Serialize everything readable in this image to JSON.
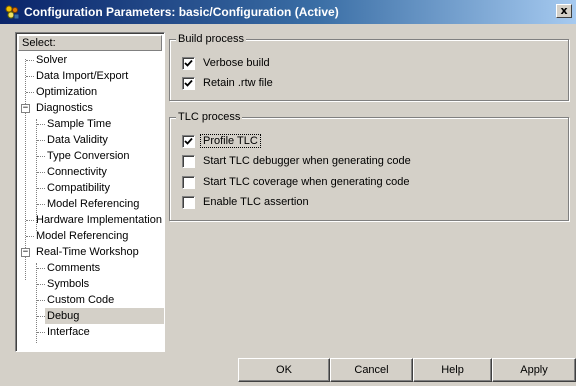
{
  "window": {
    "title": "Configuration Parameters: basic/Configuration (Active)",
    "close_glyph": "x"
  },
  "tree": {
    "header": "Select:",
    "items": [
      {
        "label": "Solver",
        "level": 1
      },
      {
        "label": "Data Import/Export",
        "level": 1
      },
      {
        "label": "Optimization",
        "level": 1
      },
      {
        "label": "Diagnostics",
        "level": 1,
        "expanded": true
      },
      {
        "label": "Sample Time",
        "level": 2
      },
      {
        "label": "Data Validity",
        "level": 2
      },
      {
        "label": "Type Conversion",
        "level": 2
      },
      {
        "label": "Connectivity",
        "level": 2
      },
      {
        "label": "Compatibility",
        "level": 2
      },
      {
        "label": "Model Referencing",
        "level": 2
      },
      {
        "label": "Hardware Implementation",
        "level": 1
      },
      {
        "label": "Model Referencing",
        "level": 1
      },
      {
        "label": "Real-Time Workshop",
        "level": 1,
        "expanded": true
      },
      {
        "label": "Comments",
        "level": 2
      },
      {
        "label": "Symbols",
        "level": 2
      },
      {
        "label": "Custom Code",
        "level": 2
      },
      {
        "label": "Debug",
        "level": 2,
        "selected": true
      },
      {
        "label": "Interface",
        "level": 2
      }
    ]
  },
  "build_process": {
    "legend": "Build process",
    "options": [
      {
        "label": "Verbose build",
        "checked": true
      },
      {
        "label": "Retain .rtw file",
        "checked": true
      }
    ]
  },
  "tlc_process": {
    "legend": "TLC process",
    "options": [
      {
        "label": "Profile TLC",
        "checked": true,
        "focused": true
      },
      {
        "label": "Start TLC debugger when generating code",
        "checked": false
      },
      {
        "label": "Start TLC coverage when generating code",
        "checked": false
      },
      {
        "label": "Enable TLC assertion",
        "checked": false
      }
    ]
  },
  "buttons": {
    "ok": "OK",
    "cancel": "Cancel",
    "help": "Help",
    "apply": "Apply"
  },
  "colors": {
    "title_start": "#0a246a",
    "title_end": "#a6caf0",
    "face": "#d4d0c8"
  }
}
